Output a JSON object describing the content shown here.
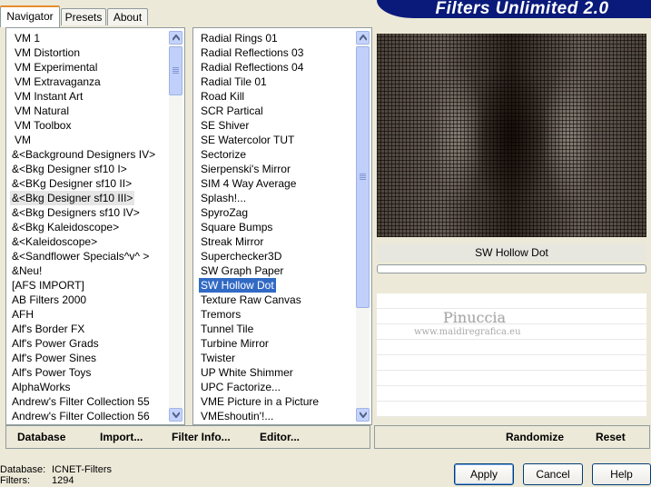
{
  "app": {
    "title": "Filters Unlimited 2.0"
  },
  "tabs": [
    {
      "label": "Navigator"
    },
    {
      "label": "Presets"
    },
    {
      "label": "About"
    }
  ],
  "categories": [
    "VM 1",
    "VM Distortion",
    "VM Experimental",
    "VM Extravaganza",
    "VM Instant Art",
    "VM Natural",
    "VM Toolbox",
    "VM",
    "&<Background Designers IV>",
    "&<Bkg Designer sf10 I>",
    "&<BKg Designer sf10 II>",
    "&<Bkg Designer sf10 III>",
    "&<Bkg Designers sf10 IV>",
    "&<Bkg Kaleidoscope>",
    "&<Kaleidoscope>",
    "&<Sandflower Specials^v^ >",
    "&Neu!",
    "[AFS IMPORT]",
    "AB Filters 2000",
    "AFH",
    "Alf's Border FX",
    "Alf's Power Grads",
    "Alf's Power Sines",
    "Alf's Power Toys",
    "AlphaWorks",
    "Andrew's Filter Collection 55",
    "Andrew's Filter Collection 56"
  ],
  "categories_selected": "&<Bkg Designer sf10 III>",
  "filters": [
    "Radial  Rings 01",
    "Radial Reflections 03",
    "Radial Reflections 04",
    "Radial Tile 01",
    "Road Kill",
    "SCR  Partical",
    "SE Shiver",
    "SE Watercolor TUT",
    "Sectorize",
    "Sierpenski's Mirror",
    "SIM 4 Way Average",
    "Splash!...",
    "SpyroZag",
    "Square Bumps",
    "Streak Mirror",
    "Superchecker3D",
    "SW Graph Paper",
    "SW Hollow Dot",
    "Texture Raw Canvas",
    "Tremors",
    "Tunnel Tile",
    "Turbine Mirror",
    "Twister",
    "UP White Shimmer",
    "UPC Factorize...",
    "VME Picture in a Picture",
    "VMEshoutin'!..."
  ],
  "filters_selected": "SW Hollow Dot",
  "preview": {
    "filter_name": "SW Hollow Dot"
  },
  "watermark": {
    "name": "Pinuccia",
    "url": "www.maidiregrafica.eu"
  },
  "bottom_links": {
    "database": "Database",
    "import": "Import...",
    "filter_info": "Filter Info...",
    "editor": "Editor...",
    "randomize": "Randomize",
    "reset": "Reset"
  },
  "status": {
    "database_label": "Database:",
    "database_value": "ICNET-Filters",
    "filters_label": "Filters:",
    "filters_value": "1294"
  },
  "buttons": {
    "apply": "Apply",
    "cancel": "Cancel",
    "help": "Help"
  },
  "colors": {
    "brand": "#0a1a7a",
    "selection": "#316ac5",
    "tab_accent": "#e68b2c"
  },
  "icons": [
    "scroll-up-icon",
    "scroll-down-icon"
  ]
}
